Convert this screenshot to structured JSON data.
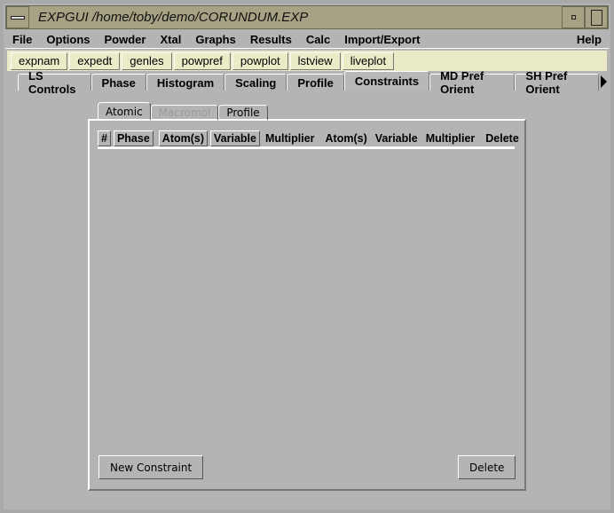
{
  "window": {
    "title": "EXPGUI /home/toby/demo/CORUNDUM.EXP"
  },
  "menu": [
    "File",
    "Options",
    "Powder",
    "Xtal",
    "Graphs",
    "Results",
    "Calc",
    "Import/Export"
  ],
  "menu_help": "Help",
  "toolbar": [
    "expnam",
    "expedt",
    "genles",
    "powpref",
    "powplot",
    "lstview",
    "liveplot"
  ],
  "tabs": [
    "LS Controls",
    "Phase",
    "Histogram",
    "Scaling",
    "Profile",
    "Constraints",
    "MD Pref Orient",
    "SH Pref Orient"
  ],
  "active_tab": "Constraints",
  "subtabs": [
    "Atomic",
    "Macromol",
    "Profile"
  ],
  "active_subtab": "Atomic",
  "disabled_subtab": "Macromol",
  "columns": [
    "#",
    "Phase",
    "Atom(s)",
    "Variable",
    "Multiplier",
    "Atom(s)",
    "Variable",
    "Multiplier",
    "Delete"
  ],
  "buttons": {
    "new": "New Constraint",
    "delete": "Delete"
  },
  "colors": {
    "titlebar": "#a8a284",
    "toolbar": "#ebebc8",
    "background": "#b4b4b4"
  }
}
